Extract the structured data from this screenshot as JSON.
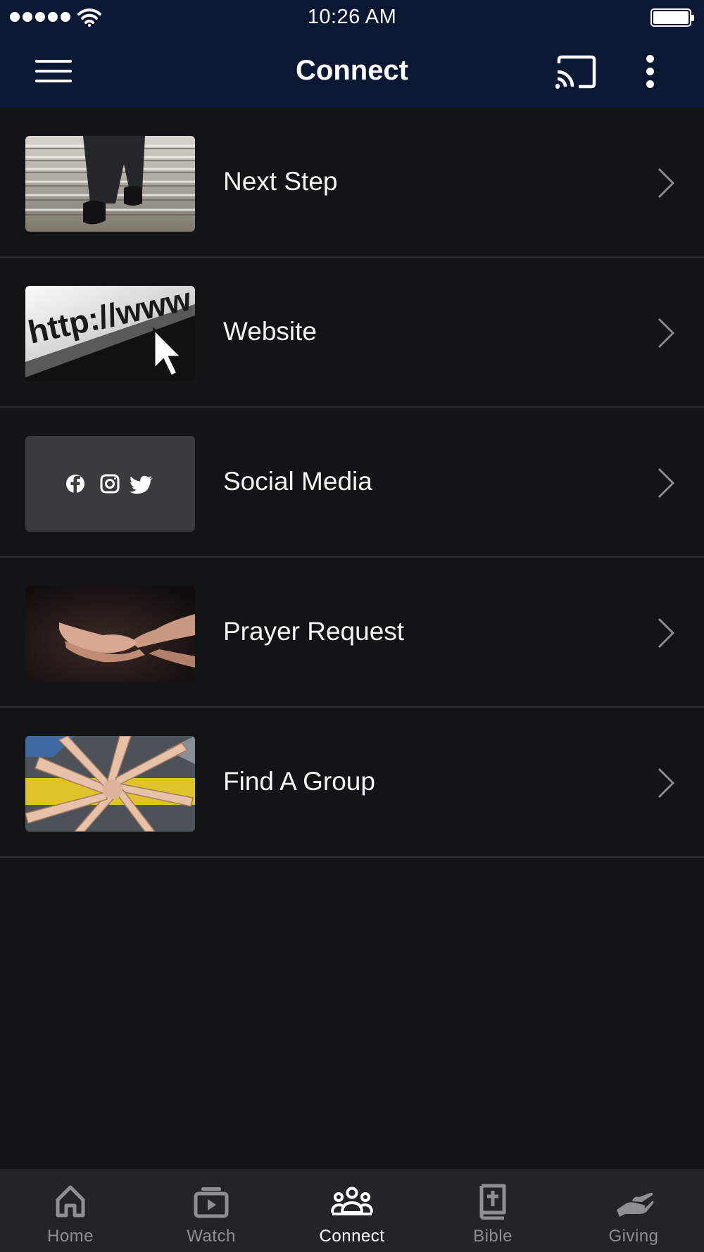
{
  "status_bar": {
    "time": "10:26 AM"
  },
  "header": {
    "title": "Connect",
    "menu_icon": "hamburger-menu-icon",
    "cast_icon": "cast-icon",
    "more_icon": "more-vertical-icon"
  },
  "list": {
    "items": [
      {
        "label": "Next Step",
        "image": "staircase-walking-photo"
      },
      {
        "label": "Website",
        "image": "http-www-cursor-photo"
      },
      {
        "label": "Social Media",
        "image": "social-icons-tile"
      },
      {
        "label": "Prayer Request",
        "image": "open-hands-photo"
      },
      {
        "label": "Find A Group",
        "image": "group-hands-photo"
      }
    ]
  },
  "thumbs": {
    "website_text": "http://www"
  },
  "tabbar": {
    "tabs": [
      {
        "label": "Home",
        "icon": "home-icon"
      },
      {
        "label": "Watch",
        "icon": "watch-icon"
      },
      {
        "label": "Connect",
        "icon": "people-icon"
      },
      {
        "label": "Bible",
        "icon": "bible-icon"
      },
      {
        "label": "Giving",
        "icon": "giving-hand-icon"
      }
    ],
    "active": "Connect"
  },
  "colors": {
    "header_bg": "#0b1833",
    "page_bg": "#131416",
    "tabbar_bg": "#232427",
    "inactive_tab": "#8d8f94",
    "active_tab": "#ffffff"
  }
}
